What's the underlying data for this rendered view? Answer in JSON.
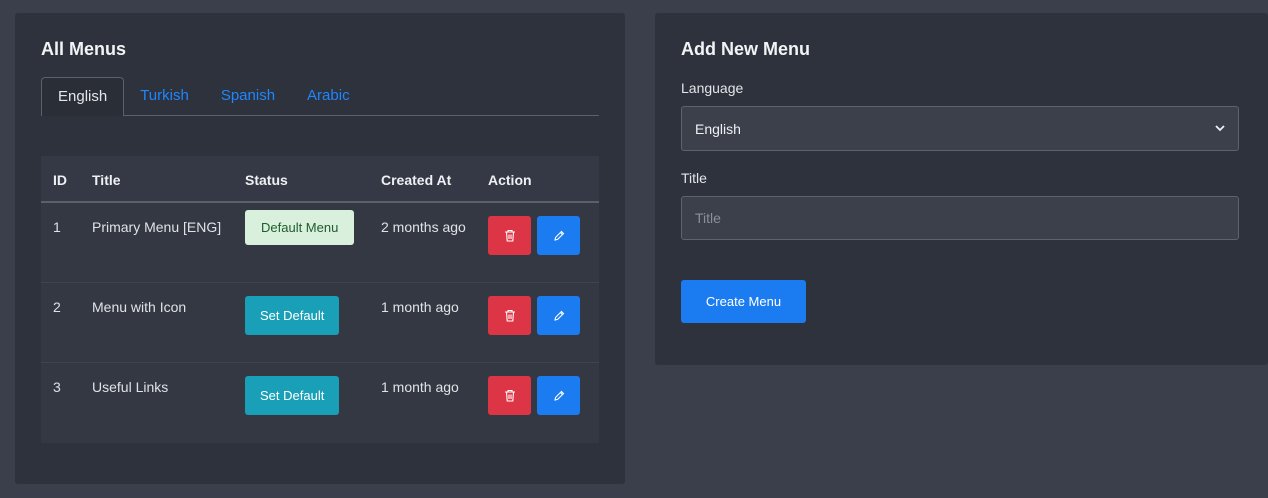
{
  "all_menus": {
    "title": "All Menus",
    "tabs": [
      {
        "label": "English",
        "active": true
      },
      {
        "label": "Turkish",
        "active": false
      },
      {
        "label": "Spanish",
        "active": false
      },
      {
        "label": "Arabic",
        "active": false
      }
    ],
    "table": {
      "headers": {
        "id": "ID",
        "title": "Title",
        "status": "Status",
        "created_at": "Created At",
        "action": "Action"
      },
      "rows": [
        {
          "id": "1",
          "title": "Primary Menu [ENG]",
          "status": "Default Menu",
          "status_type": "default",
          "created_at": "2 months ago"
        },
        {
          "id": "2",
          "title": "Menu with Icon",
          "status": "Set Default",
          "status_type": "button",
          "created_at": "1 month ago"
        },
        {
          "id": "3",
          "title": "Useful Links",
          "status": "Set Default",
          "status_type": "button",
          "created_at": "1 month ago"
        }
      ]
    }
  },
  "add_menu": {
    "title": "Add New Menu",
    "language_label": "Language",
    "language_value": "English",
    "title_label": "Title",
    "title_placeholder": "Title",
    "submit_label": "Create Menu"
  },
  "colors": {
    "accent": "#1a7cf0",
    "danger": "#dc3545",
    "info": "#19a0b8",
    "success_bg": "#d8f0dc"
  }
}
